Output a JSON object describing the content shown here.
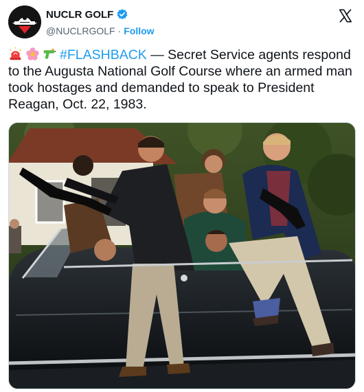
{
  "account": {
    "display_name": "NUCLR GOLF",
    "handle": "@NUCLRGOLF",
    "separator": "·",
    "follow_label": "Follow"
  },
  "icons": {
    "avatar": "nuclr-golf-logo",
    "verified": "verified-badge-icon",
    "platform": "x-logo-icon",
    "emoji": [
      "rotating-light-emoji",
      "flower-emoji",
      "water-pistol-emoji"
    ]
  },
  "post": {
    "hashtag": "#FLASHBACK",
    "body": " — Secret Service agents respond to the Augusta National Golf Course where an armed man took hostages and demanded to speak to President Reagan, Oct. 22, 1983."
  },
  "colors": {
    "accent": "#1d9bf0",
    "text": "#0f1419",
    "muted": "#536471"
  }
}
